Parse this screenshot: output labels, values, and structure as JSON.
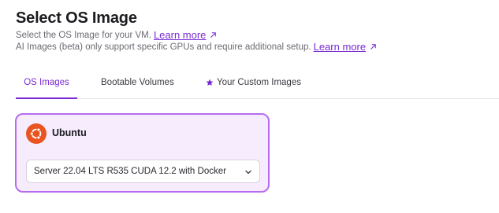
{
  "header": {
    "title": "Select OS Image",
    "description": "Select the OS Image for your VM.",
    "description_link": "Learn more",
    "ai_note": "AI Images (beta) only support specific GPUs and require additional setup.",
    "ai_note_link": "Learn more"
  },
  "tabs": [
    {
      "label": "OS Images",
      "active": true
    },
    {
      "label": "Bootable Volumes",
      "active": false
    },
    {
      "label": "Your Custom Images",
      "active": false,
      "icon": "star-icon"
    }
  ],
  "os_card": {
    "name": "Ubuntu",
    "icon": "ubuntu-logo",
    "selected": true,
    "version_select": "Server 22.04 LTS R535 CUDA 12.2 with Docker"
  },
  "colors": {
    "accent": "#7a2bd4",
    "card_border": "#b66cf0",
    "card_bg": "#f6ecfe",
    "ubuntu_orange": "#e95420"
  }
}
